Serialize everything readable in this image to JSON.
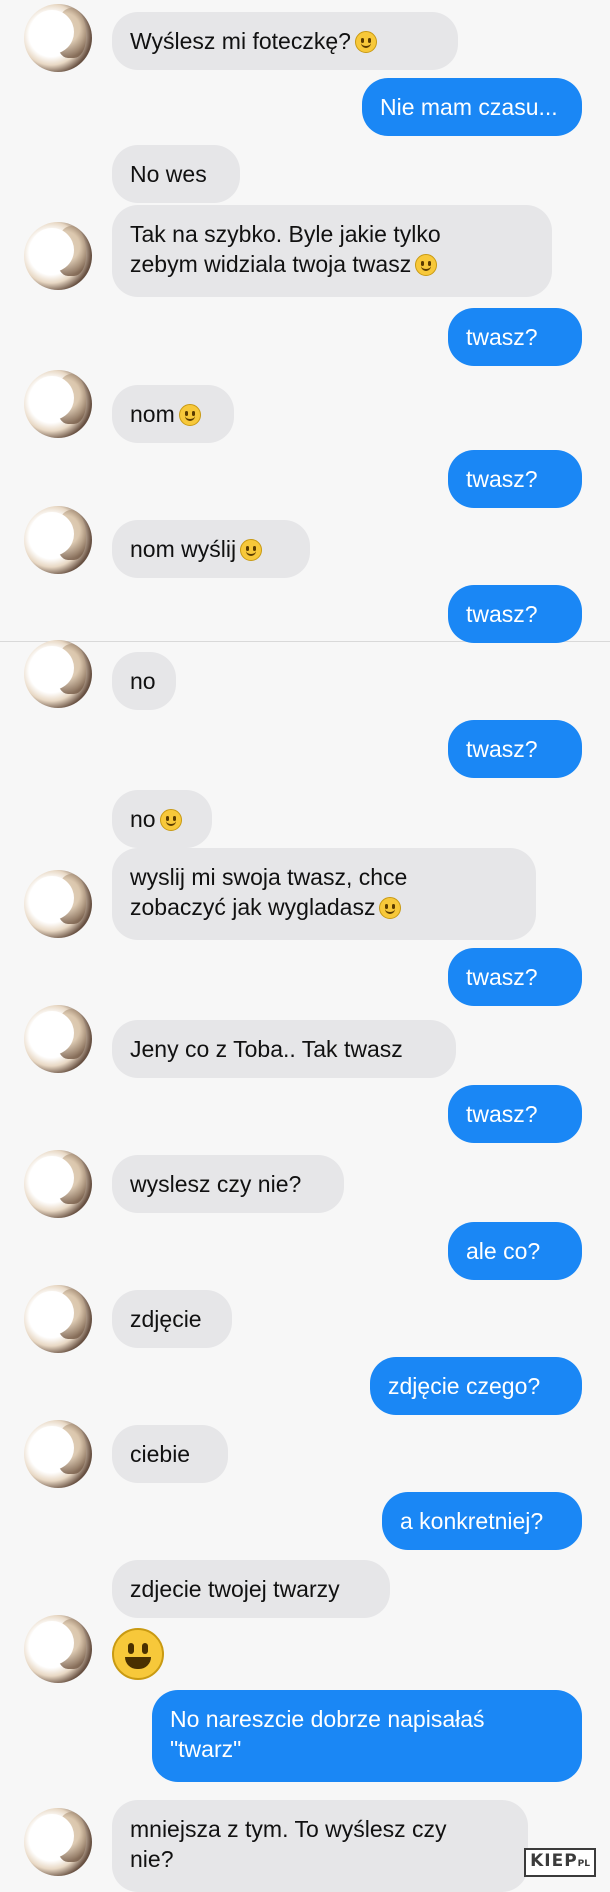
{
  "messages": [
    {
      "side": "in",
      "text": "Wyślesz mi foteczkę?",
      "emoji": "smile-emoji"
    },
    {
      "side": "out",
      "text": "Nie mam czasu..."
    },
    {
      "side": "in",
      "text": "No wes"
    },
    {
      "side": "in",
      "text": "Tak na szybko. Byle jakie tylko\nzebym widziala twoja twasz",
      "emoji": "smile-emoji"
    },
    {
      "side": "out",
      "text": "twasz?"
    },
    {
      "side": "in",
      "text": "nom",
      "emoji": "grin-emoji"
    },
    {
      "side": "out",
      "text": "twasz?"
    },
    {
      "side": "in",
      "text": "nom wyślij",
      "emoji": "tongue-wink-emoji"
    },
    {
      "side": "out",
      "text": "twasz?"
    },
    {
      "side": "in",
      "text": "no"
    },
    {
      "side": "out",
      "text": "twasz?"
    },
    {
      "side": "in",
      "text": "no",
      "emoji": "grin-emoji"
    },
    {
      "side": "in",
      "text": "wyslij mi swoja twasz, chce\nzobaczyć jak wygladasz",
      "emoji": "tongue-wink-emoji"
    },
    {
      "side": "out",
      "text": "twasz?"
    },
    {
      "side": "in",
      "text": "Jeny co z Toba.. Tak twasz"
    },
    {
      "side": "out",
      "text": "twasz?"
    },
    {
      "side": "in",
      "text": "wyslesz czy nie?"
    },
    {
      "side": "out",
      "text": "ale co?"
    },
    {
      "side": "in",
      "text": "zdjęcie"
    },
    {
      "side": "out",
      "text": "zdjęcie czego?"
    },
    {
      "side": "in",
      "text": "ciebie"
    },
    {
      "side": "out",
      "text": "a konkretniej?"
    },
    {
      "side": "in",
      "text": "zdjecie twojej twarzy"
    },
    {
      "side": "in",
      "emoji_only": "big-grin-emoji"
    },
    {
      "side": "out",
      "text": "No nareszcie dobrze napisałaś\n\"twarz\""
    },
    {
      "side": "in",
      "text": "mniejsza z tym. To wyślesz czy\nnie?"
    }
  ],
  "watermark": {
    "main": "KIEP",
    "suffix": "PL"
  },
  "colors": {
    "outgoing": "#1a87f5",
    "incoming": "#e6e6e8",
    "background": "#f7f7f7"
  }
}
